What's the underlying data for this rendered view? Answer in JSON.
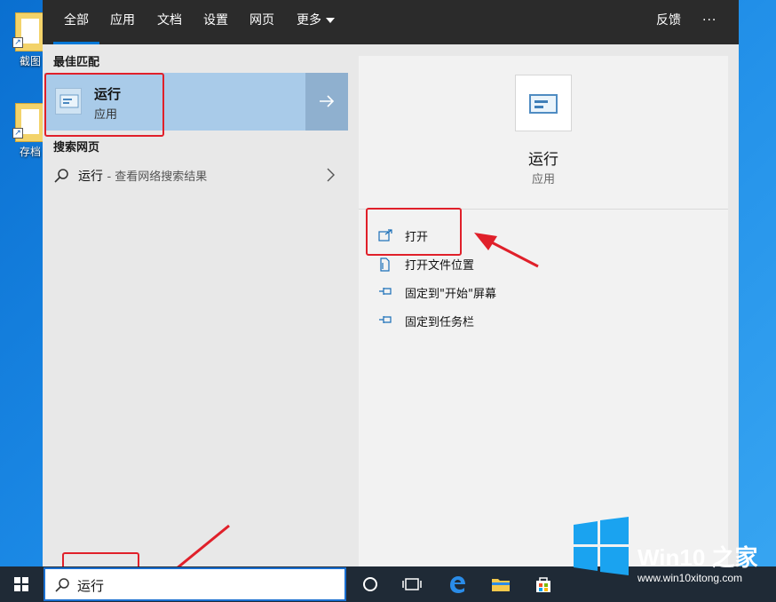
{
  "desktop": {
    "icons": [
      {
        "label": "截图"
      },
      {
        "label": "存档"
      }
    ]
  },
  "tabs": [
    {
      "label": "全部",
      "active": true
    },
    {
      "label": "应用"
    },
    {
      "label": "文档"
    },
    {
      "label": "设置"
    },
    {
      "label": "网页"
    },
    {
      "label": "更多"
    }
  ],
  "header": {
    "feedback": "反馈",
    "more_options": "···"
  },
  "results": {
    "best_match_title": "最佳匹配",
    "best_match": {
      "name": "运行",
      "type": "应用",
      "icon": "run-icon"
    },
    "web_title": "搜索网页",
    "web_item": {
      "query": "运行",
      "hint": "- 查看网络搜索结果"
    }
  },
  "details": {
    "name": "运行",
    "type": "应用",
    "actions": [
      {
        "label": "打开",
        "icon": "open-icon"
      },
      {
        "label": "打开文件位置",
        "icon": "file-location-icon"
      },
      {
        "label": "固定到\"开始\"屏幕",
        "icon": "pin-icon"
      },
      {
        "label": "固定到任务栏",
        "icon": "pin-icon"
      }
    ]
  },
  "taskbar": {
    "search_value": "运行",
    "icons": [
      "windows-start-icon",
      "search-icon",
      "cortana-icon",
      "task-view-icon",
      "edge-icon",
      "file-explorer-icon",
      "store-icon"
    ]
  },
  "watermark": {
    "brand": "Win10 之家",
    "url": "www.win10xitong.com"
  },
  "colors": {
    "accent": "#0078d7",
    "highlight": "#e0202a",
    "best_match_bg": "#a9cbe9"
  }
}
